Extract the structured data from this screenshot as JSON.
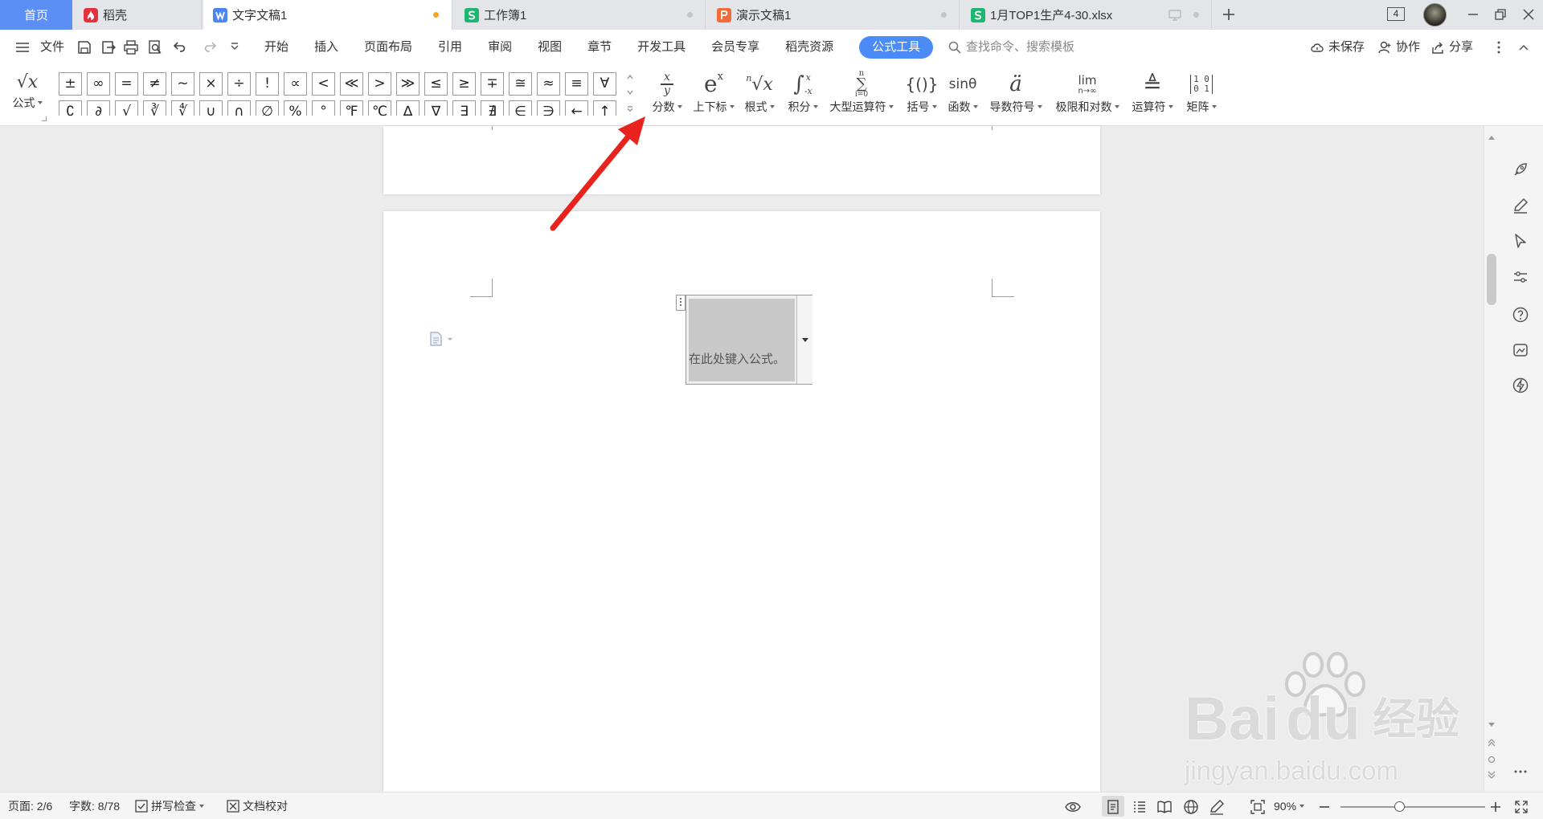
{
  "colors": {
    "home_tab": "#5b8ff6",
    "writer": "#4a86f5",
    "sheet": "#1fb572",
    "presentation": "#f26b3a",
    "docer": "#e3323b",
    "active_pill": "#4a8bf7",
    "arrow": "#e8221c",
    "modified_dot": "#f5a623"
  },
  "tabs": {
    "home": "首页",
    "items": [
      {
        "label": "稻壳",
        "icon": "docer-icon"
      },
      {
        "label": "文字文稿1",
        "icon": "writer-icon",
        "modified": true
      },
      {
        "label": "工作簿1",
        "icon": "sheet-icon"
      },
      {
        "label": "演示文稿1",
        "icon": "presentation-icon"
      },
      {
        "label": "1月TOP1生产4-30.xlsx",
        "icon": "sheet-icon"
      }
    ],
    "window_count": "4"
  },
  "menu": {
    "file": "文件",
    "items": [
      "开始",
      "插入",
      "页面布局",
      "引用",
      "审阅",
      "视图",
      "章节",
      "开发工具",
      "会员专享",
      "稻壳资源",
      "公式工具"
    ],
    "active": "公式工具",
    "search_placeholder": "查找命令、搜索模板",
    "unsaved": "未保存",
    "collaborate": "协作",
    "share": "分享"
  },
  "ribbon": {
    "formula": "公式",
    "formula_glyph": "√x",
    "symbols_row1": [
      "±",
      "∞",
      "=",
      "≠",
      "~",
      "×",
      "÷",
      "!",
      "∝",
      "<",
      "≪",
      ">",
      "≫",
      "≤",
      "≥",
      "∓",
      "≅",
      "≈",
      "≡",
      "∀"
    ],
    "symbols_row2": [
      "∁",
      "∂",
      "√",
      "∛",
      "∜",
      "∪",
      "∩",
      "∅",
      "%",
      "°",
      "℉",
      "℃",
      "∆",
      "∇",
      "∃",
      "∄",
      "∈",
      "∋",
      "←",
      "↑"
    ],
    "buttons": {
      "fraction": {
        "label": "分数",
        "num": "x",
        "den": "y"
      },
      "script": {
        "label": "上下标",
        "base": "e",
        "sup": "x"
      },
      "radical": {
        "label": "根式",
        "index": "n",
        "base": "√x"
      },
      "integral": {
        "label": "积分",
        "sym": "∫",
        "sup": "x",
        "sub": "-x"
      },
      "large_operator": {
        "label": "大型运算符",
        "sym": "∑",
        "sup": "n",
        "sub": "i=0"
      },
      "bracket": {
        "label": "括号",
        "glyph": "{()}"
      },
      "function": {
        "label": "函数",
        "glyph": "sinθ"
      },
      "accent": {
        "label": "导数符号",
        "glyph": "ä"
      },
      "limit_log": {
        "label": "极限和对数",
        "top": "lim",
        "bottom": "n→∞"
      },
      "operator": {
        "label": "运算符",
        "glyph": "≜"
      },
      "matrix": {
        "label": "矩阵",
        "row1": "1 0",
        "row2": "0 1"
      }
    }
  },
  "document": {
    "equation_placeholder": "在此处键入公式。"
  },
  "status": {
    "page": "页面: 2/6",
    "words": "字数: 8/78",
    "spell_check": "拼写检查",
    "proofread": "文档校对",
    "zoom": "90%"
  },
  "watermark": {
    "brand_left": "Bai",
    "brand_right": "du",
    "brand_cn": "经验",
    "url": "jingyan.baidu.com"
  }
}
